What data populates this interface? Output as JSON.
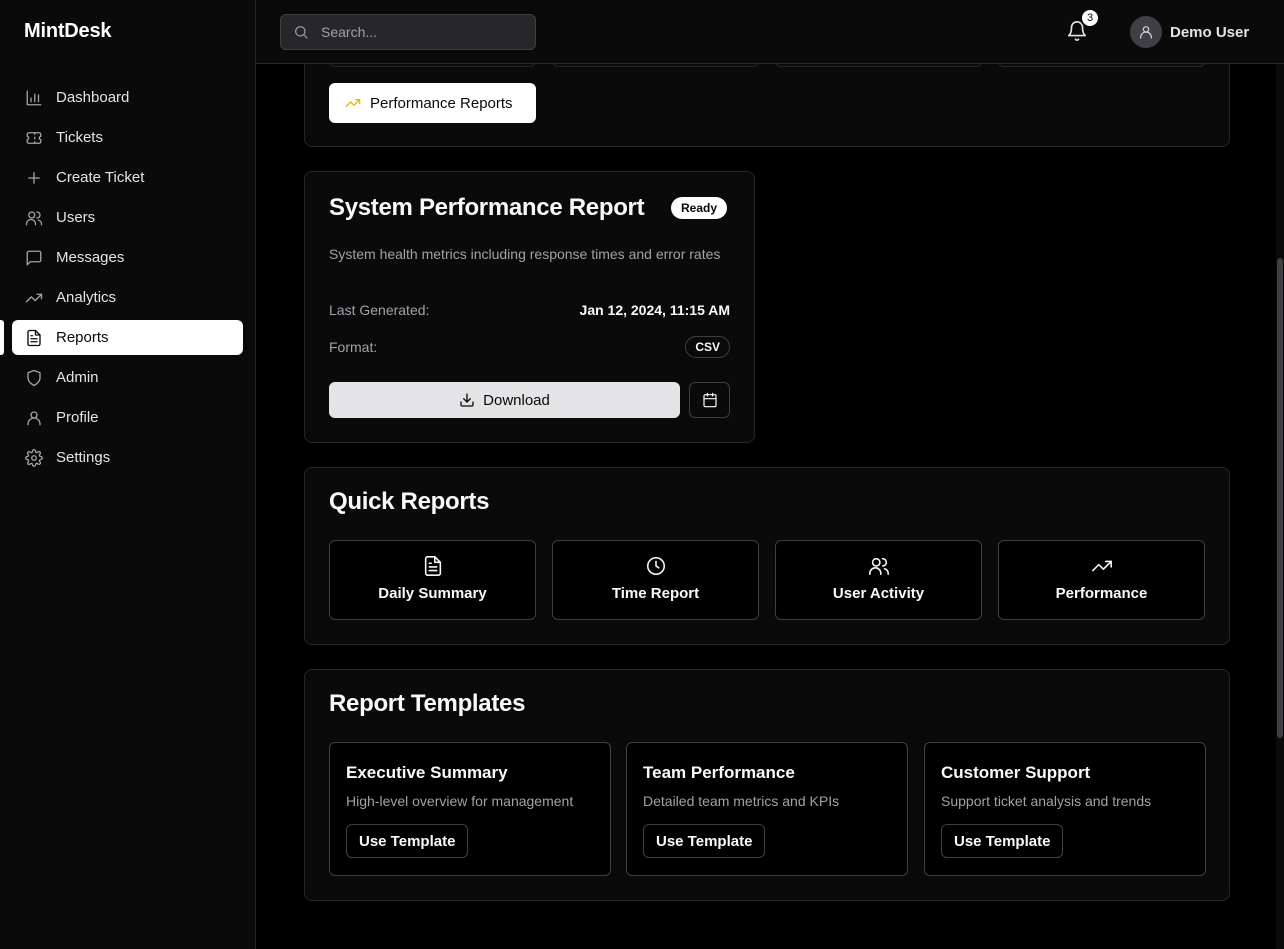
{
  "app": {
    "brand": "MintDesk"
  },
  "sidebar": {
    "items": [
      {
        "label": "Dashboard",
        "icon": "bar-chart-icon"
      },
      {
        "label": "Tickets",
        "icon": "ticket-icon"
      },
      {
        "label": "Create Ticket",
        "icon": "plus-icon"
      },
      {
        "label": "Users",
        "icon": "users-icon"
      },
      {
        "label": "Messages",
        "icon": "message-icon"
      },
      {
        "label": "Analytics",
        "icon": "trending-up-icon"
      },
      {
        "label": "Reports",
        "icon": "file-text-icon",
        "active": true
      },
      {
        "label": "Admin",
        "icon": "shield-icon"
      },
      {
        "label": "Profile",
        "icon": "user-icon"
      },
      {
        "label": "Settings",
        "icon": "gear-icon"
      }
    ]
  },
  "header": {
    "search_placeholder": "Search...",
    "notification_count": "3",
    "user_name": "Demo User"
  },
  "top_card": {
    "button_label": "Performance Reports",
    "accent_color": "#eab308"
  },
  "report": {
    "title": "System Performance Report",
    "status": "Ready",
    "description": "System health metrics including response times and error rates",
    "last_generated_label": "Last Generated:",
    "last_generated_value": "Jan 12, 2024, 11:15 AM",
    "format_label": "Format:",
    "format_value": "CSV",
    "download_label": "Download"
  },
  "quick_reports": {
    "title": "Quick Reports",
    "items": [
      {
        "label": "Daily Summary",
        "icon": "file-text-icon"
      },
      {
        "label": "Time Report",
        "icon": "clock-icon"
      },
      {
        "label": "User Activity",
        "icon": "users-icon"
      },
      {
        "label": "Performance",
        "icon": "trending-up-icon"
      }
    ]
  },
  "templates": {
    "title": "Report Templates",
    "items": [
      {
        "title": "Executive Summary",
        "description": "High-level overview for management",
        "button": "Use Template"
      },
      {
        "title": "Team Performance",
        "description": "Detailed team metrics and KPIs",
        "button": "Use Template"
      },
      {
        "title": "Customer Support",
        "description": "Support ticket analysis and trends",
        "button": "Use Template"
      }
    ]
  }
}
